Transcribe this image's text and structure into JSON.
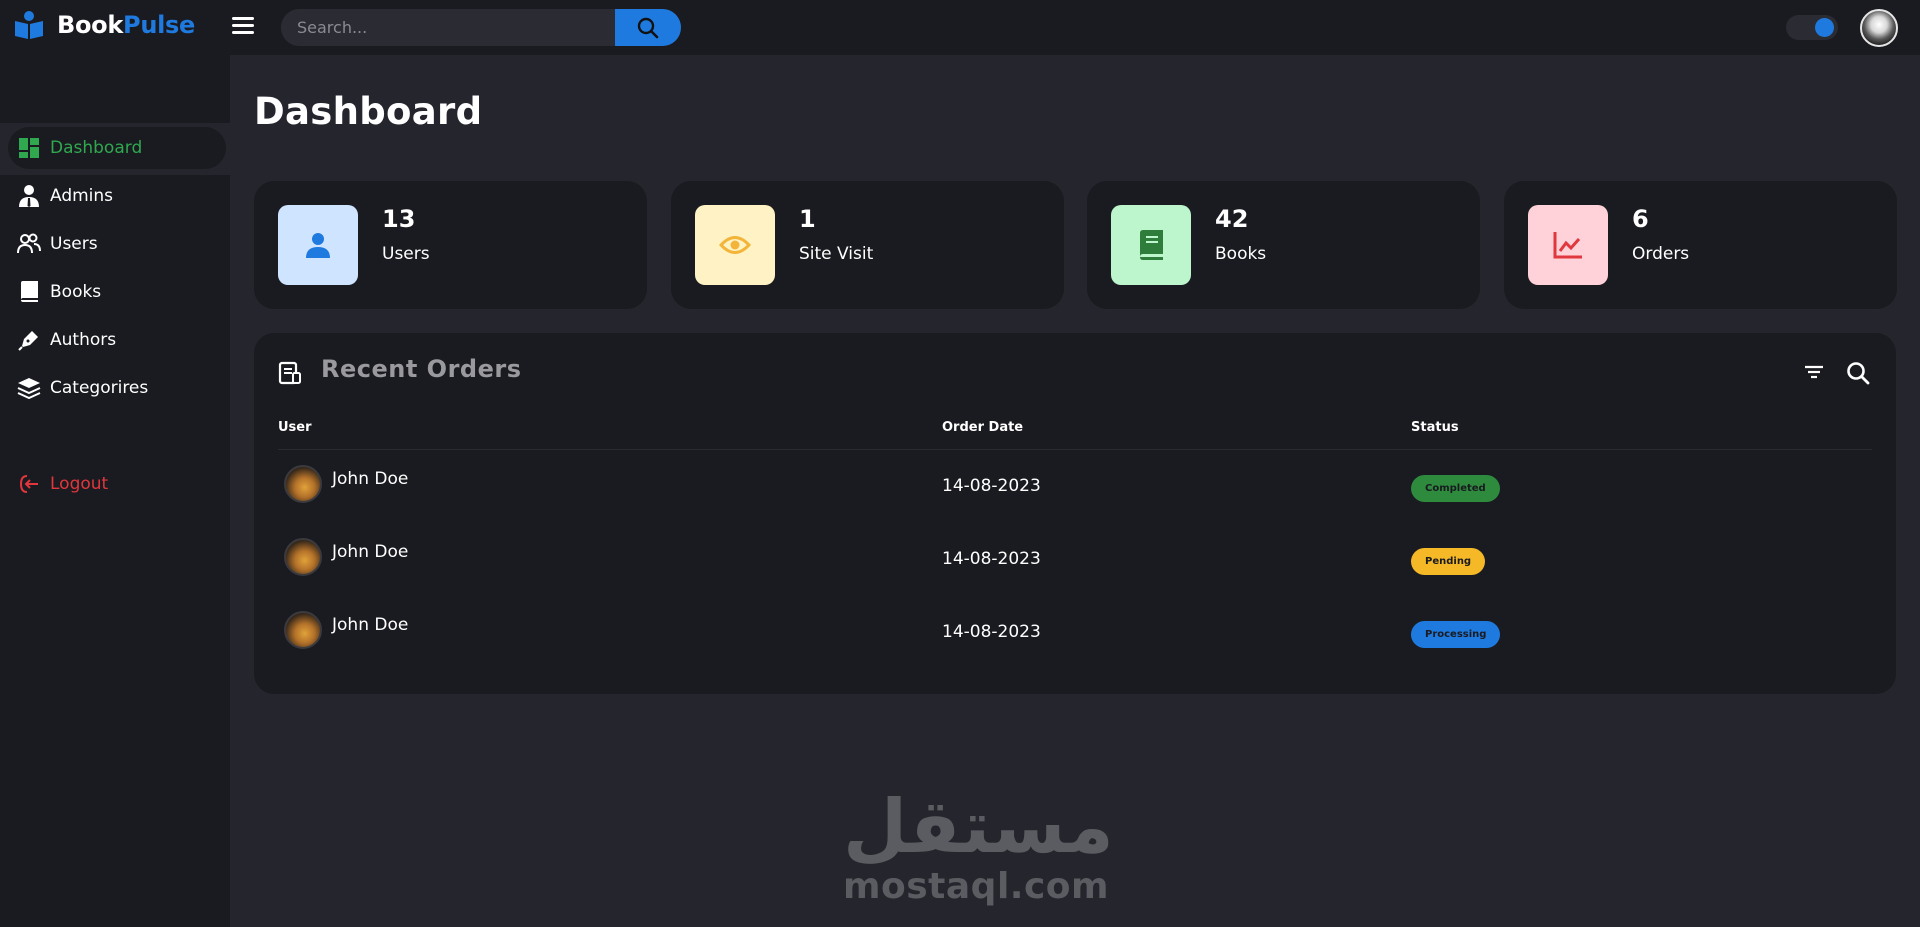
{
  "brand": {
    "part1": "Book",
    "part2": "Pulse"
  },
  "search": {
    "placeholder": "Search..."
  },
  "sidebar": {
    "items": [
      {
        "label": "Dashboard",
        "icon": "dashboard-icon",
        "active": true
      },
      {
        "label": "Admins",
        "icon": "admin-icon"
      },
      {
        "label": "Users",
        "icon": "users-icon"
      },
      {
        "label": "Books",
        "icon": "book-icon"
      },
      {
        "label": "Authors",
        "icon": "pen-icon"
      },
      {
        "label": "Categorires",
        "icon": "layers-icon"
      }
    ],
    "logout": "Logout"
  },
  "page": {
    "title": "Dashboard"
  },
  "stats": [
    {
      "value": "13",
      "label": "Users",
      "icon": "user-icon",
      "bg": "#cfe5ff",
      "fg": "#1f7ae0"
    },
    {
      "value": "1",
      "label": "Site Visit",
      "icon": "eye-icon",
      "bg": "#fff2c4",
      "fg": "#f3b43a"
    },
    {
      "value": "42",
      "label": "Books",
      "icon": "book-icon",
      "bg": "#bdf5cd",
      "fg": "#2e7d3a"
    },
    {
      "value": "6",
      "label": "Orders",
      "icon": "chart-line-icon",
      "bg": "#ffd1d8",
      "fg": "#e0363d"
    }
  ],
  "orders": {
    "title": "Recent Orders",
    "columns": [
      "User",
      "Order Date",
      "Status"
    ],
    "rows": [
      {
        "user": "John Doe",
        "date": "14-08-2023",
        "status": "Completed",
        "status_color": "#2e8b3e"
      },
      {
        "user": "John Doe",
        "date": "14-08-2023",
        "status": "Pending",
        "status_color": "#f5b928"
      },
      {
        "user": "John Doe",
        "date": "14-08-2023",
        "status": "Processing",
        "status_color": "#1f7ae0"
      }
    ]
  },
  "watermark": {
    "arabic": "مستقل",
    "latin": "mostaql.com"
  },
  "colors": {
    "accent": "#1f7ae0",
    "active": "#2fa84f",
    "danger": "#e0363d"
  }
}
